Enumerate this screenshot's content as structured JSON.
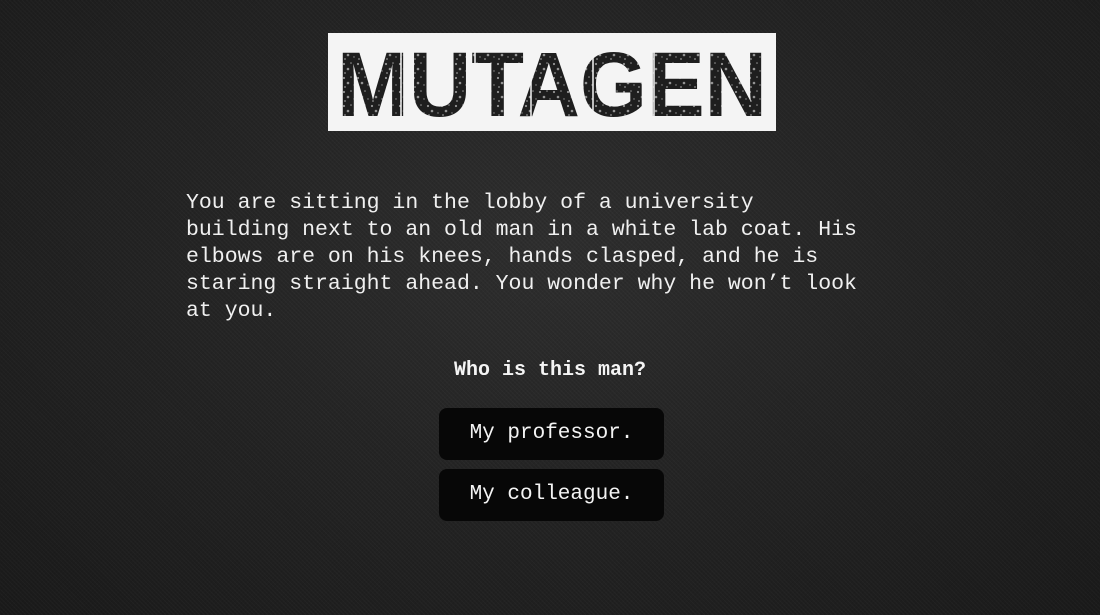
{
  "game": {
    "title": "MUTAGEN",
    "story_text": "You are sitting in the lobby of a university\nbuilding next to an old man in a white lab coat. His\nelbows are on his knees, hands clasped, and he is\nstaring straight ahead. You wonder why he won’t look\nat you.",
    "prompt": "Who is this man?",
    "choices": [
      {
        "label": "My professor."
      },
      {
        "label": "My colleague."
      }
    ]
  },
  "colors": {
    "background": "#242424",
    "text": "#f0f0f0",
    "button_background": "#070707",
    "logo_background": "#f4f4f4",
    "logo_letters": "#1e1e1e"
  }
}
